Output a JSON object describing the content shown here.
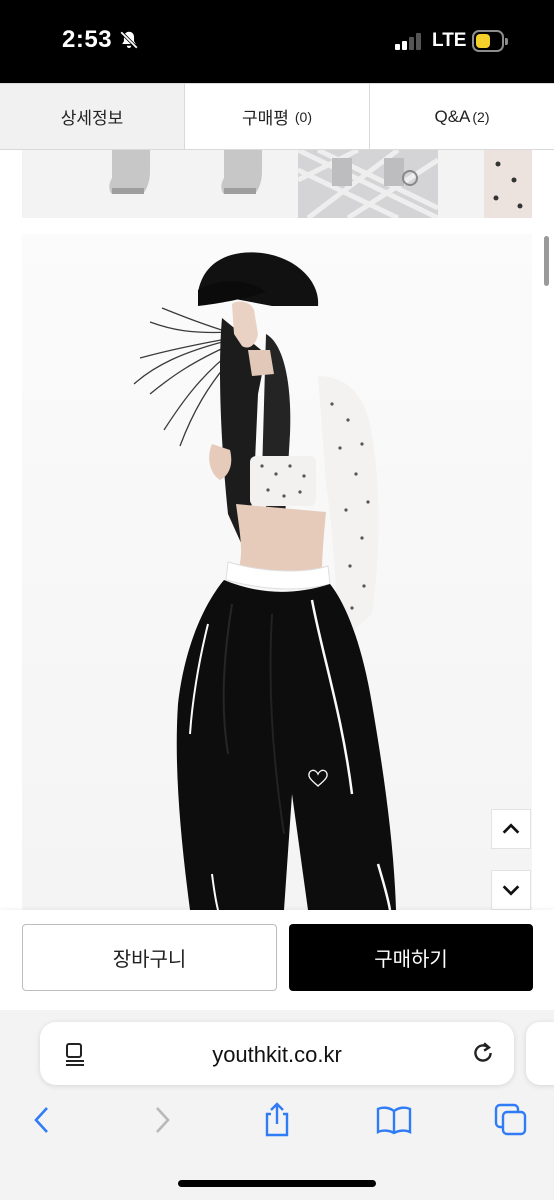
{
  "status_bar": {
    "time": "2:53",
    "network": "LTE"
  },
  "tabs": [
    {
      "label": "상세정보",
      "count": ""
    },
    {
      "label": "구매평",
      "count": "(0)"
    },
    {
      "label": "Q&A",
      "count": "(2)"
    }
  ],
  "product_image": {
    "icon": "brand-heart-logo"
  },
  "actions": {
    "cart_label": "장바구니",
    "buy_label": "구매하기"
  },
  "browser": {
    "url": "youthkit.co.kr"
  },
  "colors": {
    "accent": "#000000",
    "tab_active_bg": "#f1f1f1",
    "battery": "#f5d02a"
  }
}
